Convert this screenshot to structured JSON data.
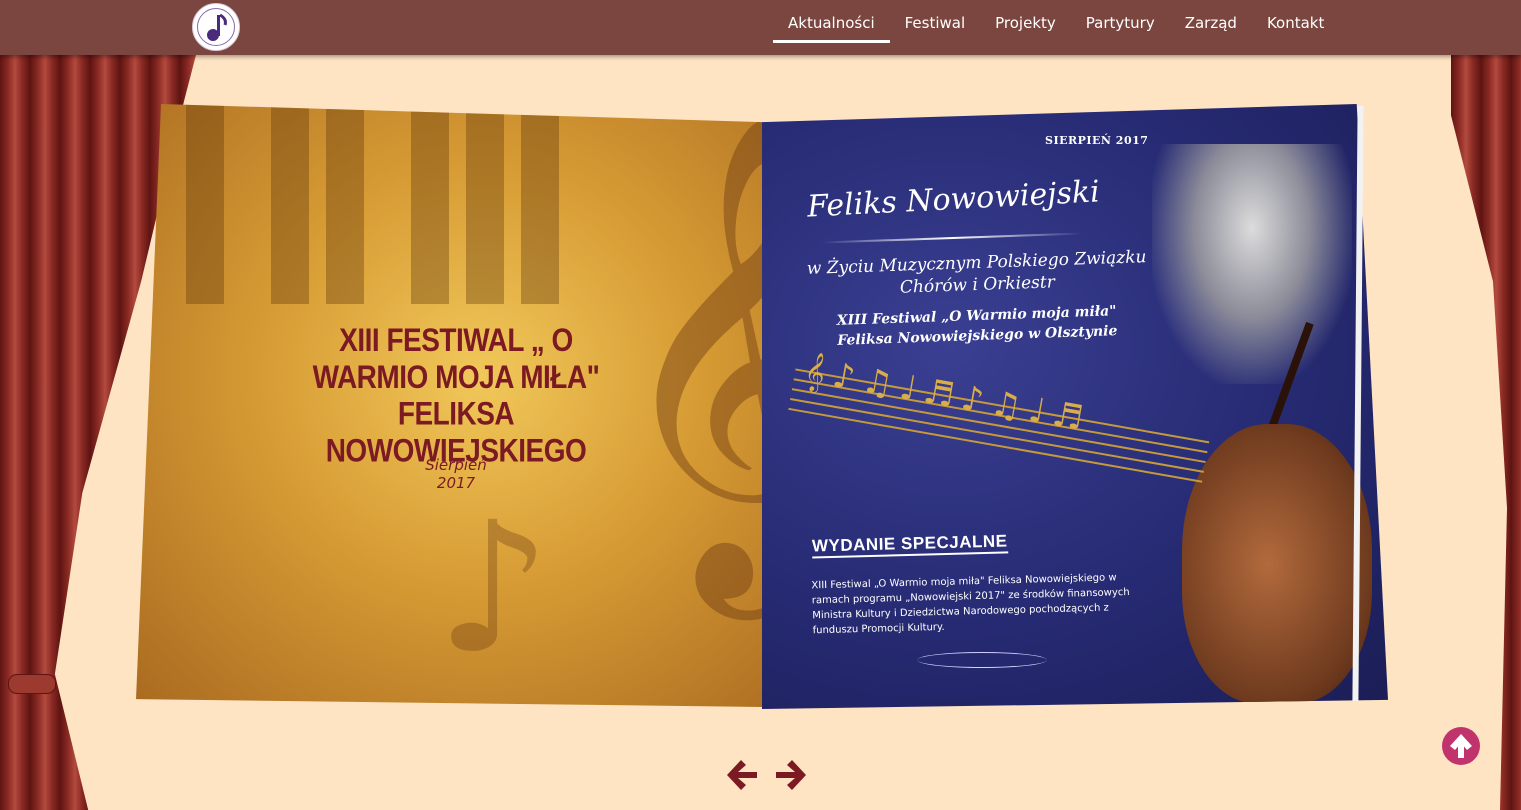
{
  "nav": {
    "items": [
      {
        "label": "Aktualności",
        "active": true
      },
      {
        "label": "Festiwal",
        "active": false
      },
      {
        "label": "Projekty",
        "active": false
      },
      {
        "label": "Partytury",
        "active": false
      },
      {
        "label": "Zarząd",
        "active": false
      },
      {
        "label": "Kontakt",
        "active": false
      }
    ]
  },
  "book": {
    "left_page": {
      "title": "XIII FESTIWAL „ O WARMIO MOJA MIŁA\" FELIKSA NOWOWIEJSKIEGO",
      "date": "Sierpień 2017"
    },
    "right_page": {
      "date": "SIERPIEŃ 2017",
      "name": "Feliks Nowowiejski",
      "subtitle": "w Życiu Muzycznym Polskiego Związku Chórów i Orkiestr",
      "festival": "XIII Festiwal „O Warmio moja miła\" Feliksa Nowowiejskiego w Olsztynie",
      "special_heading": "WYDANIE SPECJALNE",
      "body": "XIII Festiwal „O Warmio moja miła\" Feliksa Nowowiejskiego w ramach programu „Nowowiejski 2017\" ze środków finansowych Ministra Kultury i Dziedzictwa Narodowego pochodzących z funduszu Promocji Kultury."
    }
  },
  "colors": {
    "topbar": "#7a463f",
    "background": "#ffe4c4",
    "arrow": "#7b1a22",
    "scroll_top": "#c0336c"
  },
  "icons": {
    "logo": "music-note-logo",
    "prev": "arrow-left-icon",
    "next": "arrow-right-icon",
    "top": "arrow-up-circle-icon"
  }
}
